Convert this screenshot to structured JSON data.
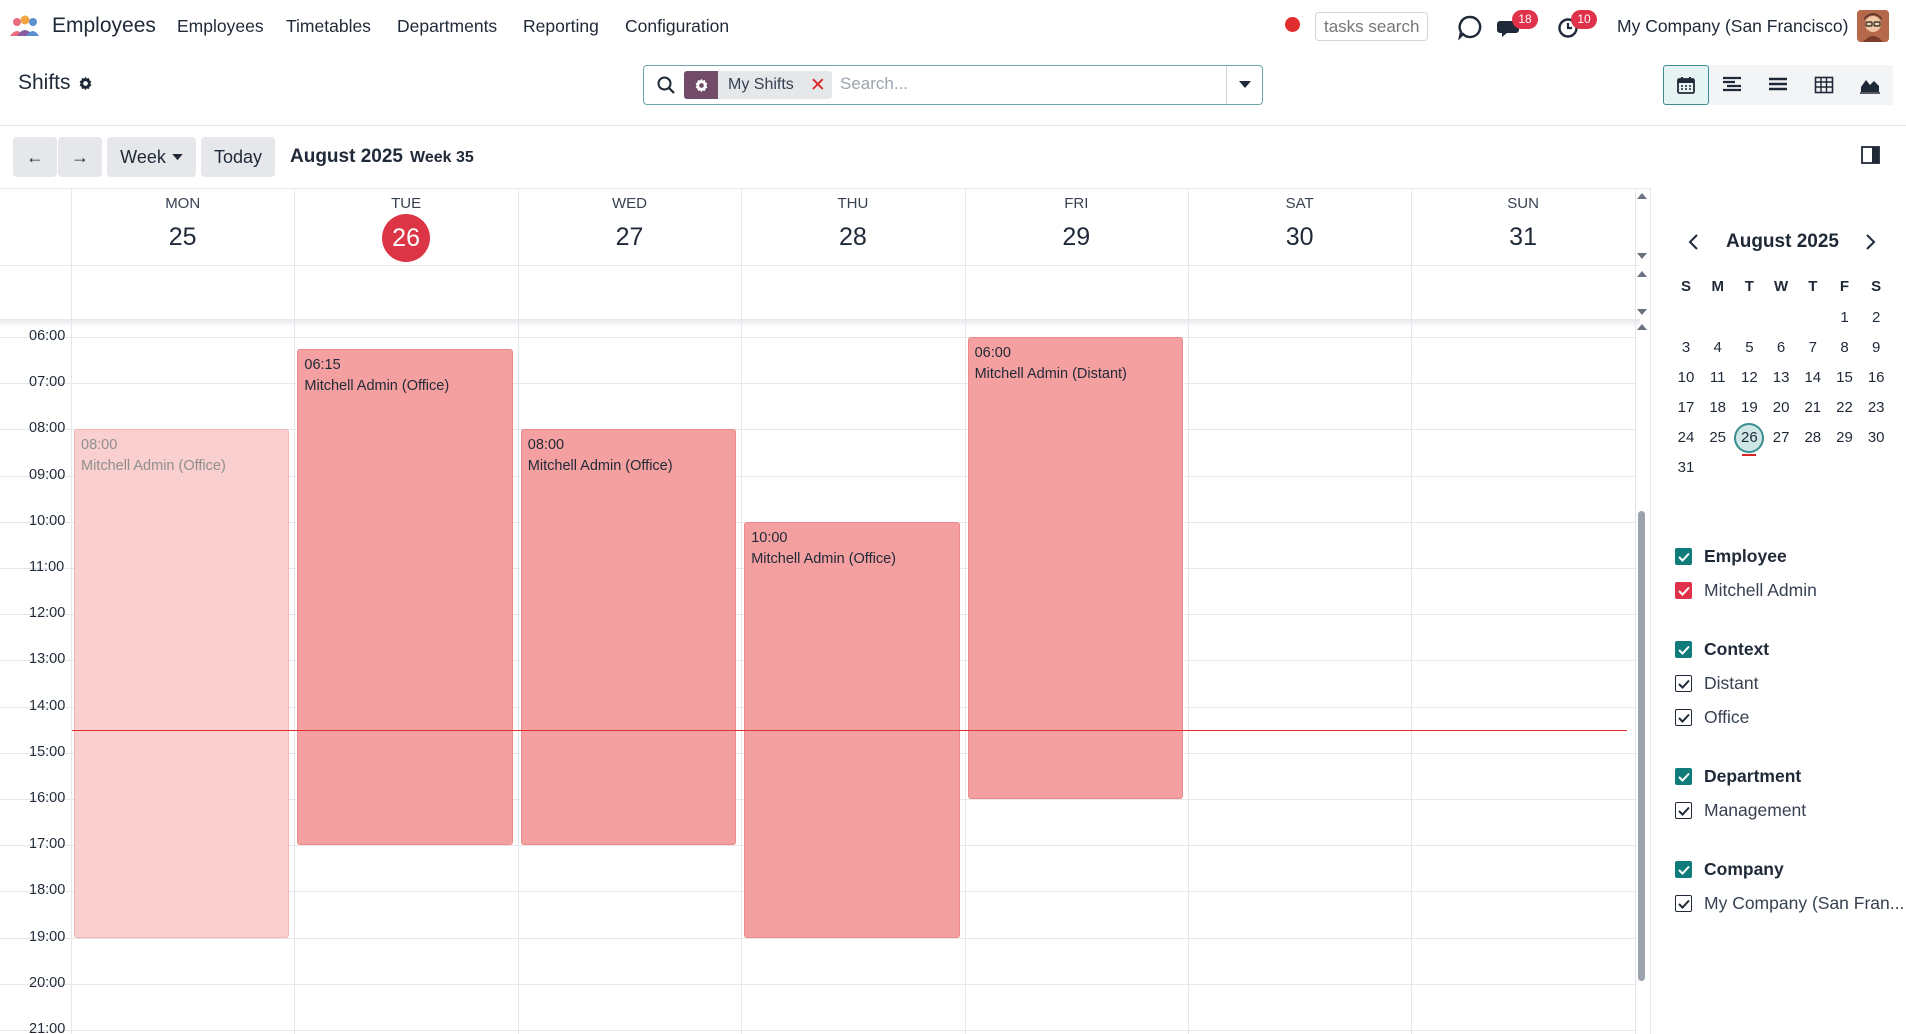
{
  "app": {
    "name": "Employees",
    "menu": [
      "Employees",
      "Timetables",
      "Departments",
      "Reporting",
      "Configuration"
    ],
    "tasks_search_placeholder": "tasks search",
    "messages_badge": "18",
    "activities_badge": "10",
    "company": "My Company (San Francisco)",
    "icons": [
      "app-logo-icon",
      "record-dot-icon",
      "voip-icon",
      "chat-icon",
      "clock-icon",
      "avatar"
    ]
  },
  "control_panel": {
    "title": "Shifts",
    "search": {
      "facet_label": "My Shifts",
      "placeholder": "Search..."
    },
    "views": [
      "calendar",
      "gantt",
      "list",
      "pivot",
      "graph"
    ],
    "active_view": "calendar"
  },
  "toolbar": {
    "prev": "←",
    "next": "→",
    "scale": "Week",
    "today": "Today",
    "period": "August 2025",
    "week": "Week 35"
  },
  "calendar": {
    "days": [
      {
        "name": "MON",
        "num": "25"
      },
      {
        "name": "TUE",
        "num": "26",
        "today": true
      },
      {
        "name": "WED",
        "num": "27"
      },
      {
        "name": "THU",
        "num": "28"
      },
      {
        "name": "FRI",
        "num": "29"
      },
      {
        "name": "SAT",
        "num": "30"
      },
      {
        "name": "SUN",
        "num": "31"
      }
    ],
    "hours": [
      "06:00",
      "07:00",
      "08:00",
      "09:00",
      "10:00",
      "11:00",
      "12:00",
      "13:00",
      "14:00",
      "15:00",
      "16:00",
      "17:00",
      "18:00",
      "19:00",
      "20:00",
      "21:00"
    ],
    "first_hour": 6,
    "now": 14.5,
    "events": [
      {
        "day": 0,
        "start": 8.0,
        "end": 19.0,
        "time": "08:00",
        "title": "Mitchell Admin (Office)",
        "past": true
      },
      {
        "day": 1,
        "start": 6.25,
        "end": 17.0,
        "time": "06:15",
        "title": "Mitchell Admin (Office)"
      },
      {
        "day": 2,
        "start": 8.0,
        "end": 17.0,
        "time": "08:00",
        "title": "Mitchell Admin (Office)"
      },
      {
        "day": 3,
        "start": 10.0,
        "end": 19.0,
        "time": "10:00",
        "title": "Mitchell Admin (Office)"
      },
      {
        "day": 4,
        "start": 6.0,
        "end": 16.0,
        "time": "06:00",
        "title": "Mitchell Admin (Distant)"
      }
    ]
  },
  "mini_calendar": {
    "title": "August 2025",
    "dow": [
      "S",
      "M",
      "T",
      "W",
      "T",
      "F",
      "S"
    ],
    "first_weekday": 5,
    "days_in_month": 31,
    "today": 26
  },
  "filters": [
    {
      "title": "Employee",
      "items": [
        {
          "label": "Mitchell Admin",
          "style": "red"
        }
      ]
    },
    {
      "title": "Context",
      "items": [
        {
          "label": "Distant",
          "style": "outline"
        },
        {
          "label": "Office",
          "style": "outline"
        }
      ]
    },
    {
      "title": "Department",
      "items": [
        {
          "label": "Management",
          "style": "outline"
        }
      ]
    },
    {
      "title": "Company",
      "items": [
        {
          "label": "My Company (San Fran...",
          "style": "outline"
        }
      ]
    }
  ]
}
